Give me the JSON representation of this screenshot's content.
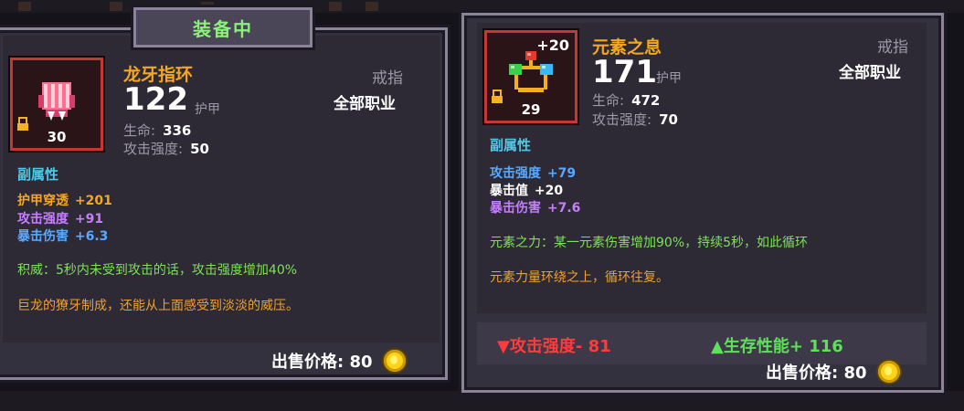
{
  "left_card": {
    "equipped_tab": "装备中",
    "item_name": "龙牙指环",
    "level": "30",
    "armor_value": "122",
    "armor_unit": "护甲",
    "item_type": "戒指",
    "class_restriction": "全部职业",
    "base_stats": [
      {
        "label": "生命:",
        "value": "336"
      },
      {
        "label": "攻击强度:",
        "value": "50"
      }
    ],
    "substats_title": "副属性",
    "substats": [
      {
        "label": "护甲穿透",
        "value": "+201",
        "color": "#f5a623"
      },
      {
        "label": "攻击强度",
        "value": "+91",
        "color": "#c77dff"
      },
      {
        "label": "暴击伤害",
        "value": "+6.3",
        "color": "#5aa9ff"
      }
    ],
    "passive": "积威：5秒内未受到攻击的话，攻击强度增加40%",
    "flavor": "巨龙的獠牙制成，还能从上面感受到淡淡的威压。",
    "sell_price": "出售价格: 80",
    "icon": "fang-ring-icon"
  },
  "right_card": {
    "item_name": "元素之息",
    "level": "29",
    "upgrade": "+20",
    "armor_value": "171",
    "armor_unit": "护甲",
    "item_type": "戒指",
    "class_restriction": "全部职业",
    "base_stats": [
      {
        "label": "生命:",
        "value": "472"
      },
      {
        "label": "攻击强度:",
        "value": "70"
      }
    ],
    "substats_title": "副属性",
    "substats": [
      {
        "label": "攻击强度",
        "value": "+79",
        "color": "#5aa9ff"
      },
      {
        "label": "暴击值",
        "value": "+20",
        "color": "#ffffff"
      },
      {
        "label": "暴击伤害",
        "value": "+7.6",
        "color": "#c77dff"
      }
    ],
    "passive": "元素之力：某一元素伤害增加90%，持续5秒，如此循环",
    "flavor": "元素力量环绕之上，循环往复。",
    "compare_down": "▼攻击强度- 81",
    "compare_up": "▲生存性能+ 116",
    "sell_price": "出售价格: 80",
    "icon": "element-ring-icon"
  },
  "colors": {
    "legendary_orange": "#f5a623",
    "rarity_border": "#c23838",
    "down_red": "#ff3b3b",
    "up_green": "#5ee05a"
  }
}
